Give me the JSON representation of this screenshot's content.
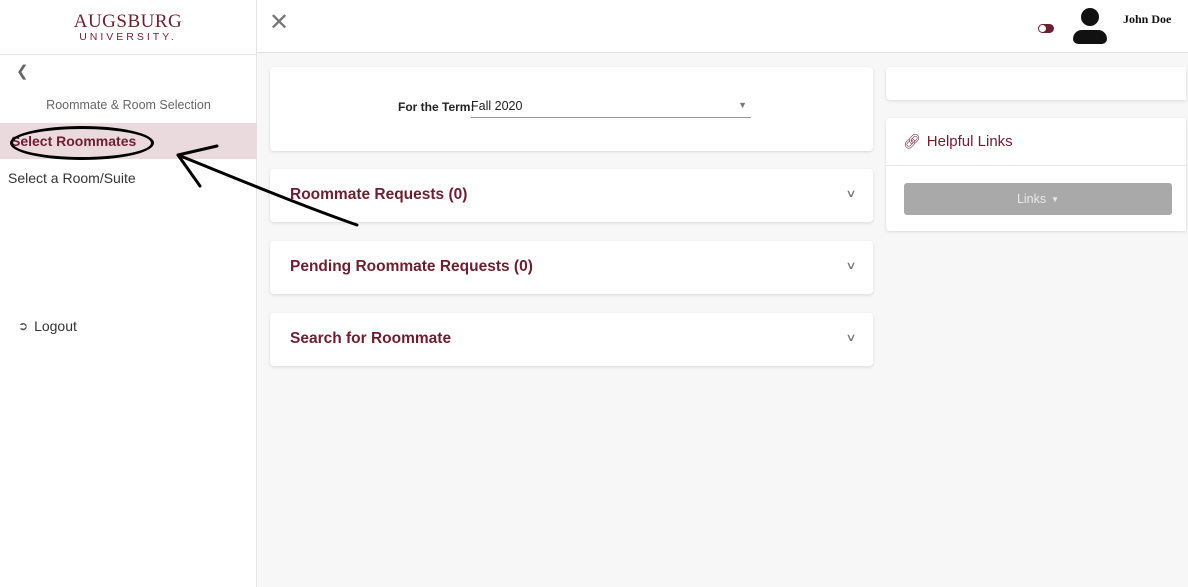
{
  "sidebar": {
    "logo_main": "AUGSBURG",
    "logo_sub": "UNIVERSITY.",
    "back_icon": "chevron-left-icon",
    "section_label": "Roommate & Room Selection",
    "items": [
      {
        "label": "Select Roommates",
        "selected": true
      },
      {
        "label": "Select a Room/Suite",
        "selected": false
      }
    ],
    "logout_label": "Logout"
  },
  "topbar": {
    "close_icon": "close-icon",
    "user_name": "John Doe"
  },
  "term": {
    "label": "For the Term:",
    "value": "Fall 2020"
  },
  "accordions": [
    {
      "title": "Roommate Requests (0)"
    },
    {
      "title": "Pending Roommate Requests (0)"
    },
    {
      "title": "Search for Roommate"
    }
  ],
  "helpful_links": {
    "title": "Helpful Links",
    "button_label": "Links"
  },
  "colors": {
    "brand": "#6d1f2f",
    "selected_bg": "#ead9dd",
    "button_disabled": "#a9a9a9",
    "background": "#f7f7f7"
  }
}
